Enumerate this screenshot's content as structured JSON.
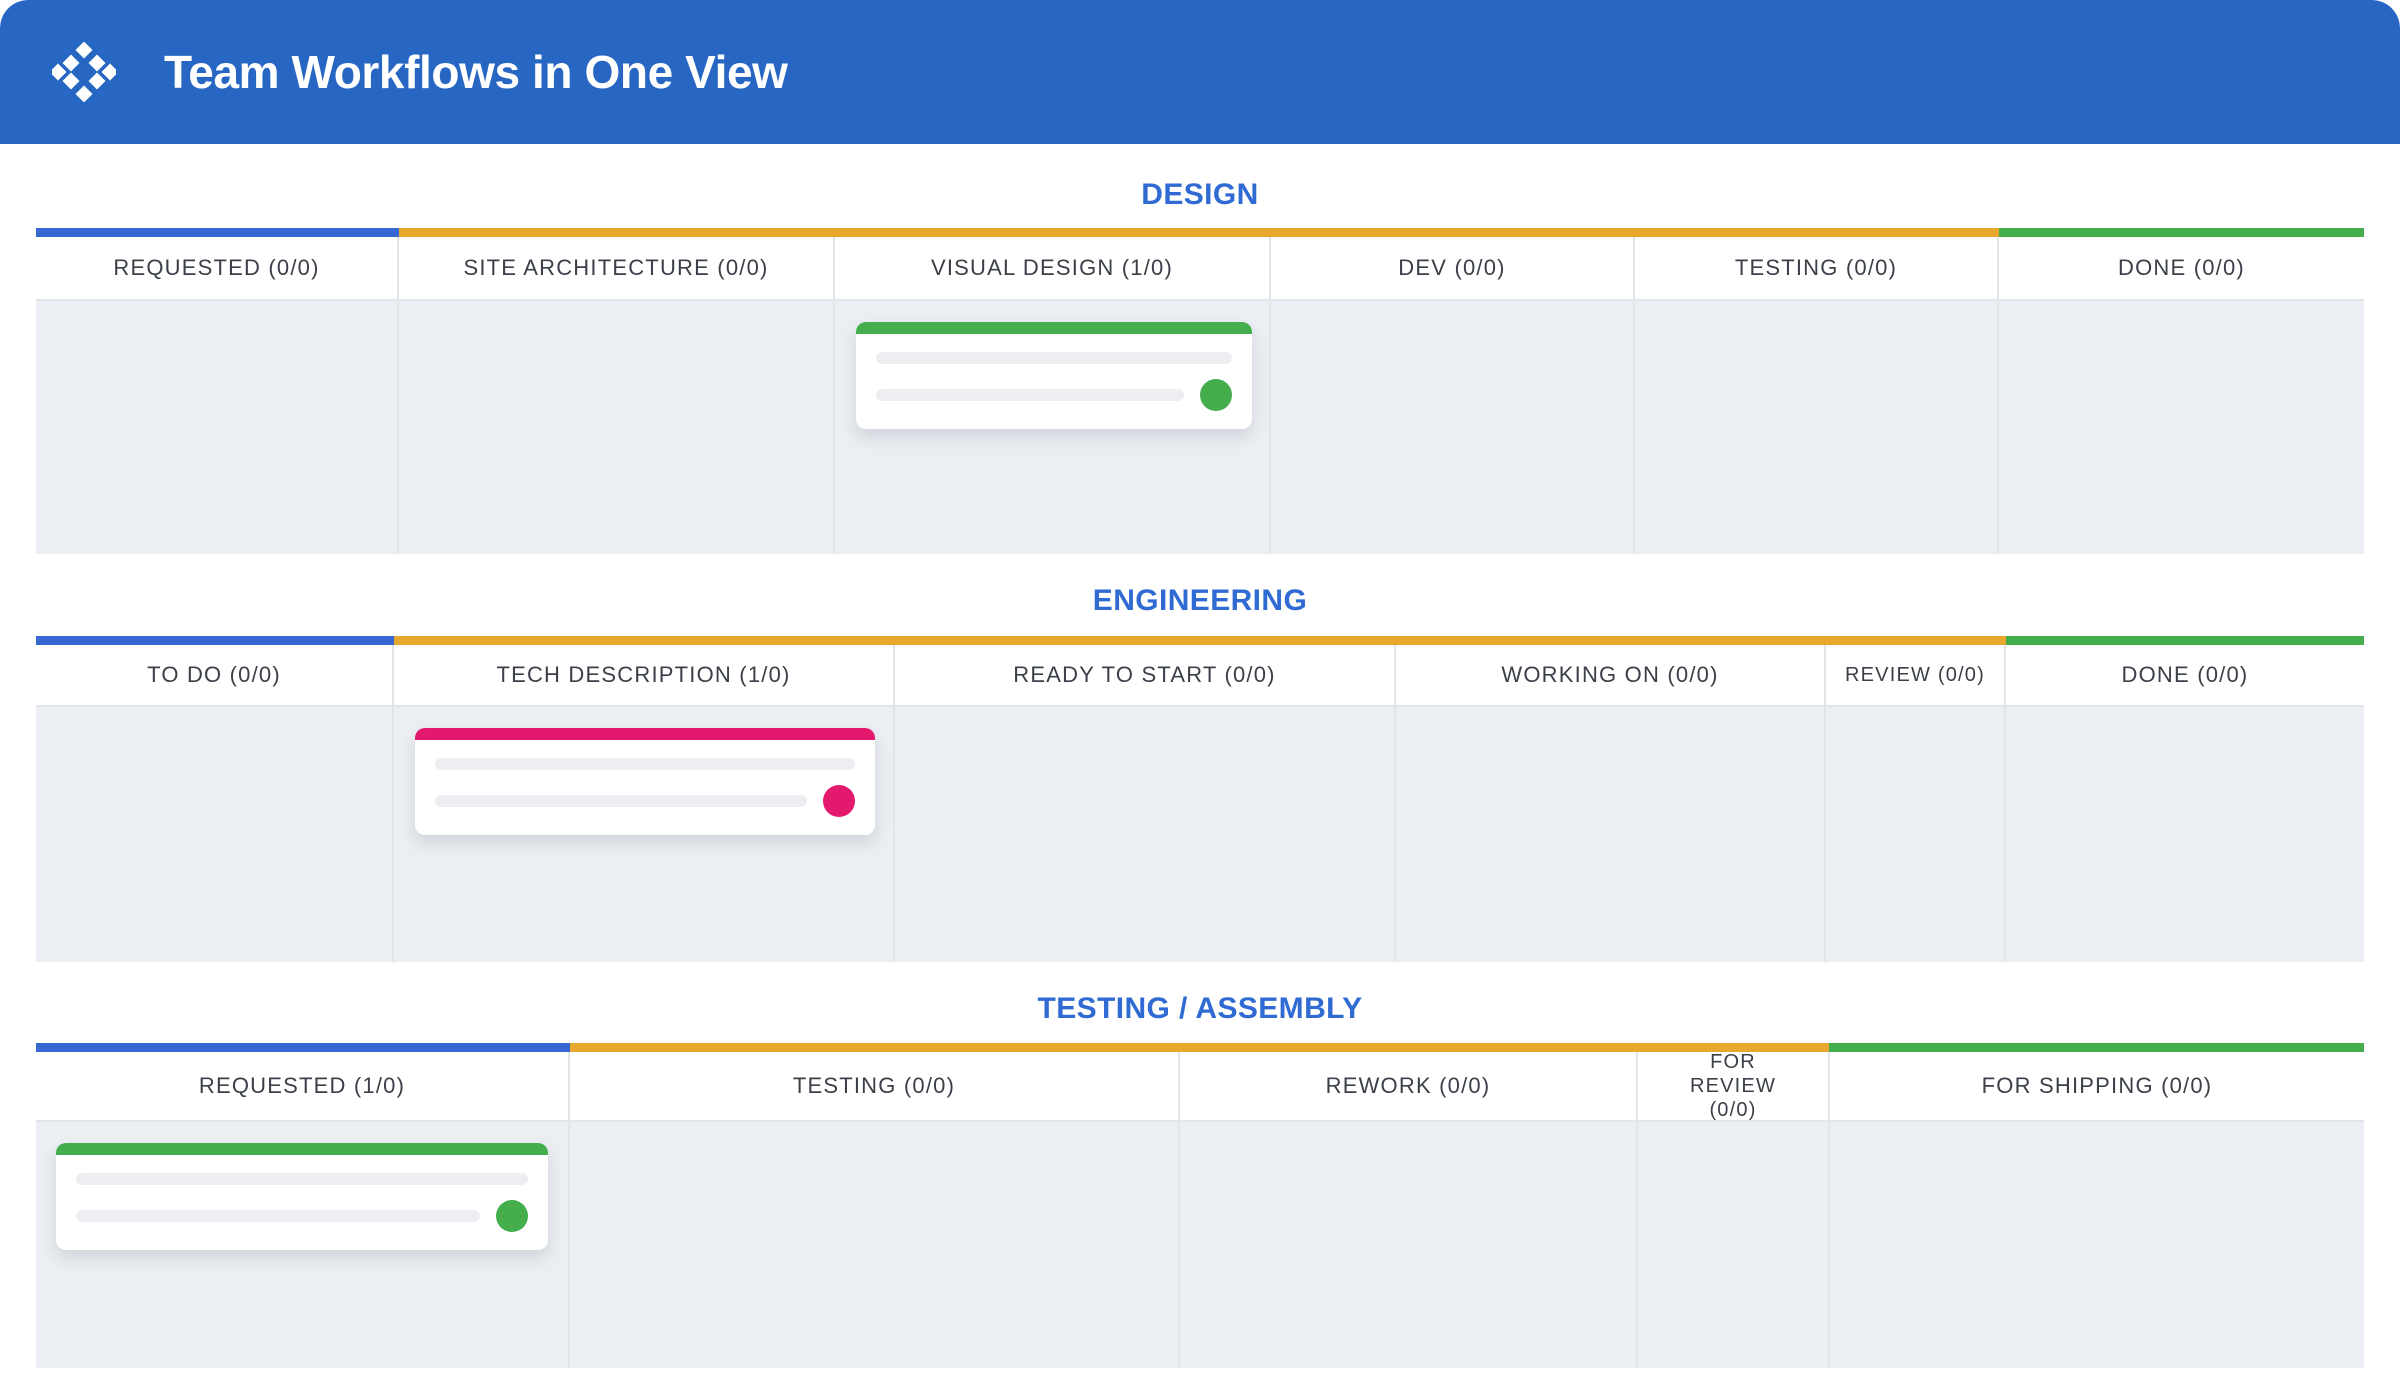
{
  "app": {
    "title": "Team Workflows in One View",
    "logo_icon": "diamond-grid-logo-icon"
  },
  "colors": {
    "header": "#2767c3",
    "title_blue": "#2f6bd2",
    "stripe_blue": "#3768d2",
    "stripe_orange": "#e8a830",
    "stripe_green": "#44ad4c",
    "card_green": "#44ad4c",
    "card_pink": "#e2196d",
    "column_bg": "#ebeef2"
  },
  "boards": [
    {
      "title": "DESIGN",
      "columns": [
        {
          "label": "REQUESTED (0/0)",
          "stripe": "blue"
        },
        {
          "label": "SITE ARCHITECTURE (0/0)",
          "stripe": "orange"
        },
        {
          "label": "VISUAL DESIGN (1/0)",
          "stripe": "orange",
          "card": {
            "color": "green"
          }
        },
        {
          "label": "DEV (0/0)",
          "stripe": "orange"
        },
        {
          "label": "TESTING (0/0)",
          "stripe": "orange"
        },
        {
          "label": "DONE (0/0)",
          "stripe": "green"
        }
      ]
    },
    {
      "title": "ENGINEERING",
      "columns": [
        {
          "label": "TO DO (0/0)",
          "stripe": "blue"
        },
        {
          "label": "TECH DESCRIPTION (1/0)",
          "stripe": "orange",
          "card": {
            "color": "pink"
          }
        },
        {
          "label": "READY TO START (0/0)",
          "stripe": "orange"
        },
        {
          "label": "WORKING ON (0/0)",
          "stripe": "orange"
        },
        {
          "label": "REVIEW (0/0)",
          "stripe": "orange"
        },
        {
          "label": "DONE (0/0)",
          "stripe": "green"
        }
      ]
    },
    {
      "title": "TESTING / ASSEMBLY",
      "columns": [
        {
          "label": "REQUESTED (1/0)",
          "stripe": "blue",
          "card": {
            "color": "green"
          }
        },
        {
          "label": "TESTING (0/0)",
          "stripe": "orange"
        },
        {
          "label": "REWORK (0/0)",
          "stripe": "orange"
        },
        {
          "label": "FOR REVIEW (0/0)",
          "stripe": "orange"
        },
        {
          "label": "FOR SHIPPING (0/0)",
          "stripe": "green"
        }
      ]
    }
  ]
}
